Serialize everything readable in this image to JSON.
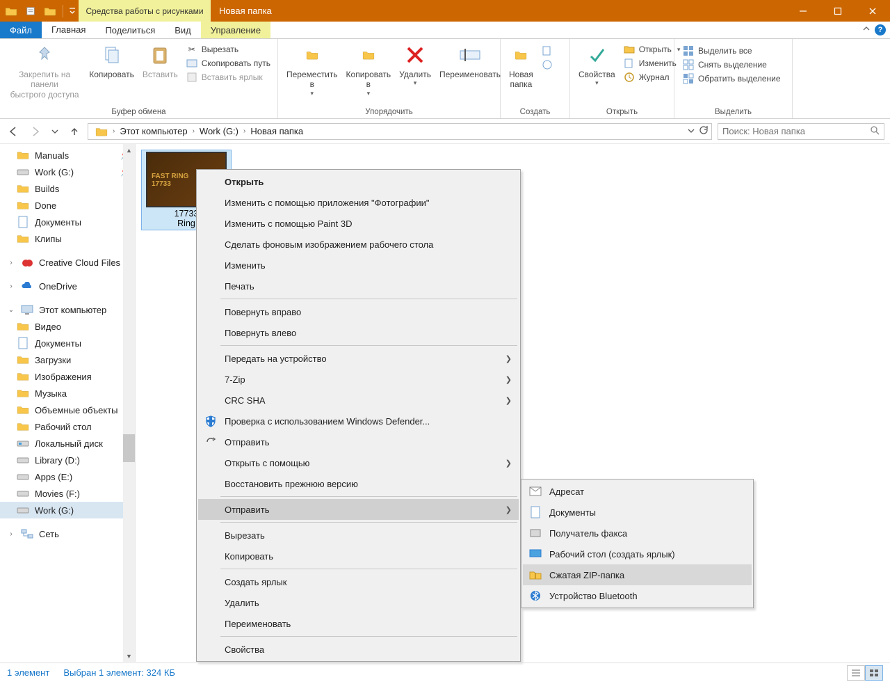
{
  "title_bar": {
    "tool_tab": "Средства работы с рисунками",
    "window_title": "Новая папка"
  },
  "tabs": {
    "file": "Файл",
    "home": "Главная",
    "share": "Поделиться",
    "view": "Вид",
    "manage": "Управление"
  },
  "ribbon": {
    "g1": {
      "pin": "Закрепить на панели\nбыстрого доступа",
      "copy": "Копировать",
      "paste": "Вставить",
      "cut": "Вырезать",
      "copypath": "Скопировать путь",
      "paste_link": "Вставить ярлык",
      "label": "Буфер обмена"
    },
    "g2": {
      "move": "Переместить\nв",
      "copy_to": "Копировать\nв",
      "delete": "Удалить",
      "rename": "Переименовать",
      "label": "Упорядочить"
    },
    "g3": {
      "new_folder": "Новая\nпапка",
      "label": "Создать"
    },
    "g4": {
      "props": "Свойства",
      "open": "Открыть",
      "edit": "Изменить",
      "history": "Журнал",
      "label": "Открыть"
    },
    "g5": {
      "sel_all": "Выделить все",
      "sel_none": "Снять выделение",
      "sel_inv": "Обратить выделение",
      "label": "Выделить"
    }
  },
  "breadcrumbs": [
    "Этот компьютер",
    "Work (G:)",
    "Новая папка"
  ],
  "search": {
    "placeholder": "Поиск: Новая папка"
  },
  "nav": {
    "qa": [
      {
        "label": "Manuals",
        "pin": true
      },
      {
        "label": "Work (G:)",
        "pin": true
      },
      {
        "label": "Builds"
      },
      {
        "label": "Done"
      },
      {
        "label": "Документы"
      },
      {
        "label": "Клипы"
      }
    ],
    "ccf": "Creative Cloud Files",
    "onedrive": "OneDrive",
    "pc": "Этот компьютер",
    "pc_items": [
      "Видео",
      "Документы",
      "Загрузки",
      "Изображения",
      "Музыка",
      "Объемные объекты",
      "Рабочий стол",
      "Локальный диск",
      "Library (D:)",
      "Apps (E:)",
      "Movies (F:)",
      "Work (G:)"
    ],
    "network": "Сеть"
  },
  "file": {
    "name": "17733\nRing",
    "thumb_text": "FAST RING\n17733"
  },
  "ctx": {
    "open": "Открыть",
    "photos": "Изменить с помощью приложения \"Фотографии\"",
    "paint3d": "Изменить с помощью Paint 3D",
    "wallpaper": "Сделать фоновым изображением рабочего стола",
    "edit": "Изменить",
    "print": "Печать",
    "rot_r": "Повернуть вправо",
    "rot_l": "Повернуть влево",
    "cast": "Передать на устройство",
    "zip7": "7-Zip",
    "crc": "CRC SHA",
    "defender": "Проверка с использованием Windows Defender...",
    "share": "Отправить",
    "open_with": "Открыть с помощью",
    "restore": "Восстановить прежнюю версию",
    "send_to": "Отправить",
    "cut": "Вырезать",
    "copy": "Копировать",
    "shortcut": "Создать ярлык",
    "delete": "Удалить",
    "rename": "Переименовать",
    "props": "Свойства"
  },
  "submenu": [
    "Адресат",
    "Документы",
    "Получатель факса",
    "Рабочий стол (создать ярлык)",
    "Сжатая ZIP-папка",
    "Устройство Bluetooth"
  ],
  "status": {
    "items": "1 элемент",
    "selection": "Выбран 1 элемент: 324 КБ"
  }
}
